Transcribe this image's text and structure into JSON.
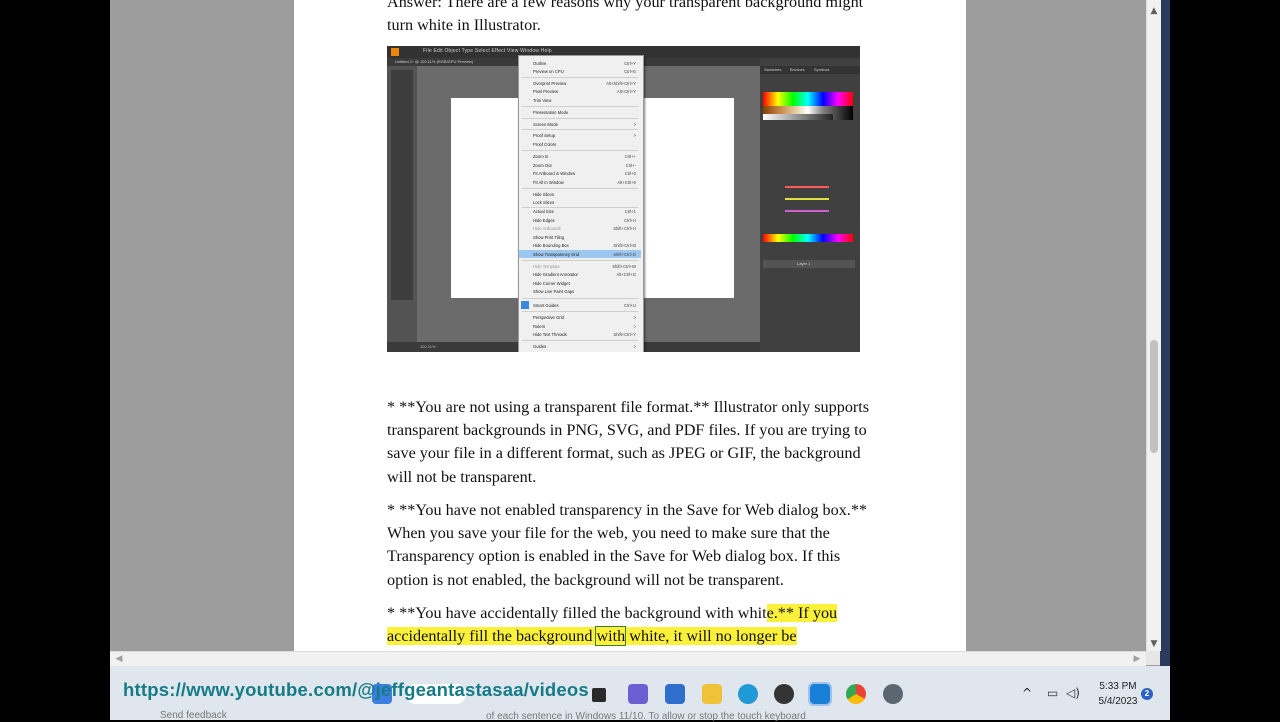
{
  "document": {
    "intro_lines": [
      "Answer: There are a few reasons why your transparent background might",
      "turn white in Illustrator."
    ],
    "para1": [
      "* **You are not using a transparent file format.** Illustrator only supports",
      "transparent backgrounds in PNG, SVG, and PDF files. If you are trying to",
      "save your file in a different format, such as JPEG or GIF, the background",
      "will not be transparent."
    ],
    "para2": [
      "* **You have not enabled transparency in the Save for Web dialog box.**",
      "When you save your file for the web, you need to make sure that the",
      "Transparency option is enabled in the Save for Web dialog box. If this",
      "option is not enabled, the background will not be transparent."
    ],
    "para3": {
      "line1_plain": "* **You have accidentally filled the background with whit",
      "line1_highlight": "e.** If you",
      "line2_a": "accidentally fill the background ",
      "line2_box": "with",
      "line2_b": " white, it will no longer be"
    },
    "highlight_color": "#fbf03a"
  },
  "illustrator": {
    "menubar": "File   Edit   Object   Type   Select   Effect   View   Window   Help",
    "doc_tab": "Untitled-1* @ 100.11% (RGB/GPU Preview)",
    "panel_tabs": [
      "Swatches",
      "Brushes",
      "Symbols"
    ],
    "zoom": "100.11%",
    "layer_name": "Layer 1",
    "view_menu": [
      {
        "label": "Outline",
        "shortcut": "Ctrl+Y"
      },
      {
        "label": "Preview on CPU",
        "shortcut": "Ctrl+E"
      },
      {
        "label": "Overprint Preview",
        "shortcut": "Alt+Shift+Ctrl+Y"
      },
      {
        "label": "Pixel Preview",
        "shortcut": "Alt+Ctrl+Y"
      },
      {
        "label": "Trim View",
        "shortcut": ""
      },
      {
        "label": "Presentation Mode",
        "shortcut": ""
      },
      {
        "label": "Screen Mode",
        "shortcut": ">"
      },
      {
        "label": "Proof Setup",
        "shortcut": ">"
      },
      {
        "label": "Proof Colors",
        "shortcut": ""
      },
      {
        "label": "Zoom In",
        "shortcut": "Ctrl++"
      },
      {
        "label": "Zoom Out",
        "shortcut": "Ctrl+-"
      },
      {
        "label": "Fit Artboard in Window",
        "shortcut": "Ctrl+0"
      },
      {
        "label": "Fit All in Window",
        "shortcut": "Alt+Ctrl+0"
      },
      {
        "label": "Hide Slices",
        "shortcut": ""
      },
      {
        "label": "Lock Slices",
        "shortcut": ""
      },
      {
        "label": "Actual Size",
        "shortcut": "Ctrl+1"
      },
      {
        "label": "Hide Edges",
        "shortcut": "Ctrl+H"
      },
      {
        "label": "Hide Artboards",
        "shortcut": "Shift+Ctrl+H"
      },
      {
        "label": "Show Print Tiling",
        "shortcut": ""
      },
      {
        "label": "Hide Bounding Box",
        "shortcut": "Shift+Ctrl+B"
      },
      {
        "label": "Show Transparency Grid",
        "shortcut": "Shift+Ctrl+D"
      },
      {
        "label": "Hide Template",
        "shortcut": "Shift+Ctrl+W"
      },
      {
        "label": "Hide Gradient Annotator",
        "shortcut": "Alt+Ctrl+G"
      },
      {
        "label": "Hide Corner Widget",
        "shortcut": ""
      },
      {
        "label": "Show Live Paint Gaps",
        "shortcut": ""
      },
      {
        "label": "Smart Guides",
        "shortcut": "Ctrl+U"
      },
      {
        "label": "Perspective Grid",
        "shortcut": ">"
      },
      {
        "label": "Rulers",
        "shortcut": ">"
      },
      {
        "label": "Hide Text Threads",
        "shortcut": "Shift+Ctrl+Y"
      },
      {
        "label": "Guides",
        "shortcut": ">"
      }
    ]
  },
  "taskbar": {
    "url_overlay": "https://www.youtube.com/@jeffgeantastasaa/videos",
    "feedback": "Send feedback",
    "shadow_text": "of each sentence in Windows 11/10. To allow or stop the touch keyboard",
    "time": "5:33 PM",
    "date": "5/4/2023",
    "notification_count": "2",
    "icons": [
      "windows-start-icon",
      "search-icon",
      "task-view-icon",
      "teams-chat-icon",
      "store-icon",
      "file-explorer-icon",
      "edge-icon",
      "media-player-icon",
      "app-icon",
      "chrome-icon",
      "settings-icon"
    ]
  },
  "colors": {
    "url": "#157c86",
    "taskbar": "#dfe6ee",
    "window_gray": "#9d9d9d"
  }
}
